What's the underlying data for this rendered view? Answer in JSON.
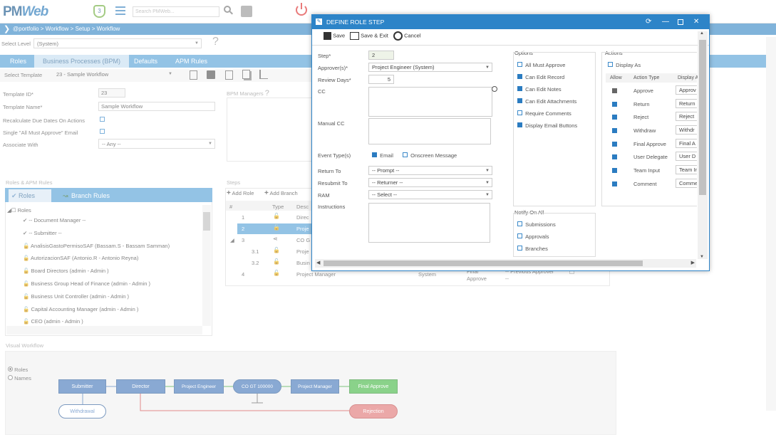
{
  "header": {
    "logo_pm": "PM",
    "logo_web": "Web",
    "badge": "3",
    "search_placeholder": "Search PMWeb..."
  },
  "breadcrumb": "@portfolio > Workflow > Setup > Workflow",
  "level": {
    "label": "Select Level",
    "value": "(System)",
    "help": "?"
  },
  "main_tabs": [
    "Roles",
    "Business Processes (BPM)",
    "Defaults",
    "APM Rules"
  ],
  "template_select": {
    "label": "Select Template",
    "value": "23 - Sample Workflow"
  },
  "form": {
    "template_id_label": "Template ID*",
    "template_id": "23",
    "template_name_label": "Template Name*",
    "template_name": "Sample Workflow",
    "recalc_label": "Recalculate Due Dates On Actions",
    "single_label": "Single \"All Must Approve\" Email",
    "associate_label": "Associate With",
    "associate_value": "-- Any --",
    "bpm_managers_label": "BPM Managers",
    "bpm_help": "?"
  },
  "roles_panel": {
    "title": "Roles & APM Rules",
    "tab_roles": "Roles",
    "tab_branch": "Branch Rules",
    "root": "Roles",
    "items": [
      "-- Document Manager --",
      "-- Submitter --",
      "AnalisisGastoPermisoSAF (Bassam.S - Bassam Samman)",
      "AutorizacionSAF (Antonio.R - Antonio Reyna)",
      "Board Directors (admin - Admin )",
      "Business Group Head of Finance (admin - Admin )",
      "Business Unit Controller (admin - Admin )",
      "Capital Accounting Manager (admin - Admin )",
      "CEO (admin - Admin )"
    ]
  },
  "steps_panel": {
    "title": "Steps",
    "add_role": "Add Role",
    "add_branch": "Add Branch",
    "col_hash": "#",
    "col_type": "Type",
    "col_desc": "Desc",
    "rows": [
      {
        "num": "1",
        "desc": "Direc"
      },
      {
        "num": "2",
        "desc": "Proje"
      },
      {
        "num": "3",
        "desc": "CO G"
      },
      {
        "num": "3.1",
        "desc": "Proje"
      },
      {
        "num": "3.2",
        "desc": "Busin"
      },
      {
        "num": "4",
        "desc": "Project Manager"
      }
    ],
    "row4_level": "System",
    "row4_action1": "Final",
    "row4_action2": "Approve",
    "row4_prev": "-- Previous Approver",
    "row4_dash": "--"
  },
  "visual": {
    "title": "Visual Workflow",
    "radio_roles": "Roles",
    "radio_names": "Names",
    "nodes": {
      "submitter": "Submitter",
      "director": "Director",
      "project_engineer": "Project Engineer",
      "co_gt": "CO GT 100000",
      "project_manager": "Project Manager",
      "final_approve": "Final Approve",
      "withdrawal": "Withdrawal",
      "rejection": "Rejection"
    }
  },
  "modal": {
    "title": "DEFINE ROLE STEP",
    "save": "Save",
    "save_exit": "Save & Exit",
    "cancel": "Cancel",
    "step_label": "Step*",
    "step_value": "2",
    "approvers_label": "Approver(s)*",
    "approvers_value": "Project Engineer (System)",
    "review_days_label": "Review Days*",
    "review_days_value": "5",
    "cc_label": "CC",
    "manual_cc_label": "Manual CC",
    "event_label": "Event Type(s)",
    "event_email": "Email",
    "event_onscreen": "Onscreen Message",
    "return_to_label": "Return To",
    "return_to_value": "-- Prompt --",
    "resubmit_label": "Resubmit To",
    "resubmit_value": "-- Returner --",
    "ram_label": "RAM",
    "ram_value": "-- Select --",
    "instructions_label": "Instructions",
    "options_title": "Options",
    "options": [
      {
        "label": "All Must Approve",
        "checked": false
      },
      {
        "label": "Can Edit Record",
        "checked": true
      },
      {
        "label": "Can Edit Notes",
        "checked": true
      },
      {
        "label": "Can Edit Attachments",
        "checked": true
      },
      {
        "label": "Require Comments",
        "checked": false
      },
      {
        "label": "Display Email Buttons",
        "checked": true
      }
    ],
    "notify_title": "Notify On All",
    "notify": [
      "Submissions",
      "Approvals",
      "Branches"
    ],
    "actions_title": "Actions",
    "display_as": "Display As",
    "col_allow": "Allow",
    "col_action_type": "Action Type",
    "col_display": "Display A",
    "actions": [
      {
        "type": "Approve",
        "display": "Approv"
      },
      {
        "type": "Return",
        "display": "Return"
      },
      {
        "type": "Reject",
        "display": "Reject"
      },
      {
        "type": "Withdraw",
        "display": "Withdr"
      },
      {
        "type": "Final Approve",
        "display": "Final A"
      },
      {
        "type": "User Delegate",
        "display": "User D"
      },
      {
        "type": "Team Input",
        "display": "Team In"
      },
      {
        "type": "Comment",
        "display": "Comme"
      }
    ]
  }
}
